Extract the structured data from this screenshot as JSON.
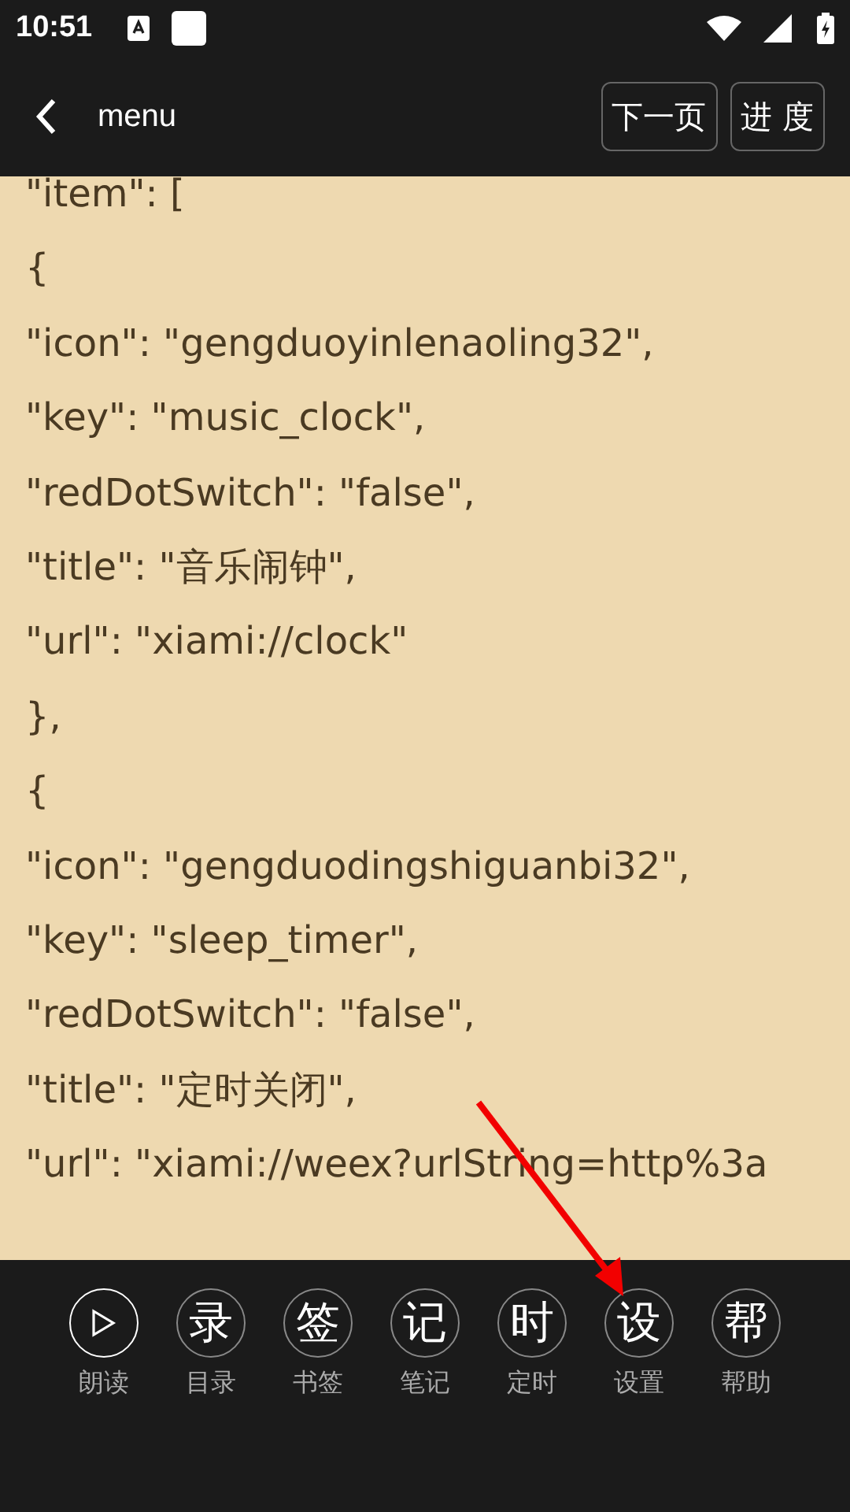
{
  "status_bar": {
    "time": "10:51"
  },
  "header": {
    "title": "menu",
    "buttons": [
      "下一页",
      "进 度"
    ]
  },
  "content": {
    "lines": [
      "\"item\": [",
      "{",
      "\"icon\": \"gengduoyinlenaoling32\",",
      "\"key\": \"music_clock\",",
      "\"redDotSwitch\": \"false\",",
      "\"title\": \"音乐闹钟\",",
      "\"url\": \"xiami://clock\"",
      "},",
      "{",
      "\"icon\": \"gengduodingshiguanbi32\",",
      "\"key\": \"sleep_timer\",",
      "\"redDotSwitch\": \"false\",",
      "\"title\": \"定时关闭\",",
      "\"url\": \"xiami://weex?urlString=http%3a"
    ]
  },
  "toolbar": [
    {
      "kind": "play",
      "label": "朗读",
      "active": true
    },
    {
      "kind": "glyph",
      "glyph": "录",
      "label": "目录",
      "active": false
    },
    {
      "kind": "glyph",
      "glyph": "签",
      "label": "书签",
      "active": false
    },
    {
      "kind": "glyph",
      "glyph": "记",
      "label": "笔记",
      "active": false
    },
    {
      "kind": "glyph",
      "glyph": "时",
      "label": "定时",
      "active": false
    },
    {
      "kind": "glyph",
      "glyph": "设",
      "label": "设置",
      "active": false
    },
    {
      "kind": "glyph",
      "glyph": "帮",
      "label": "帮助",
      "active": false
    }
  ]
}
